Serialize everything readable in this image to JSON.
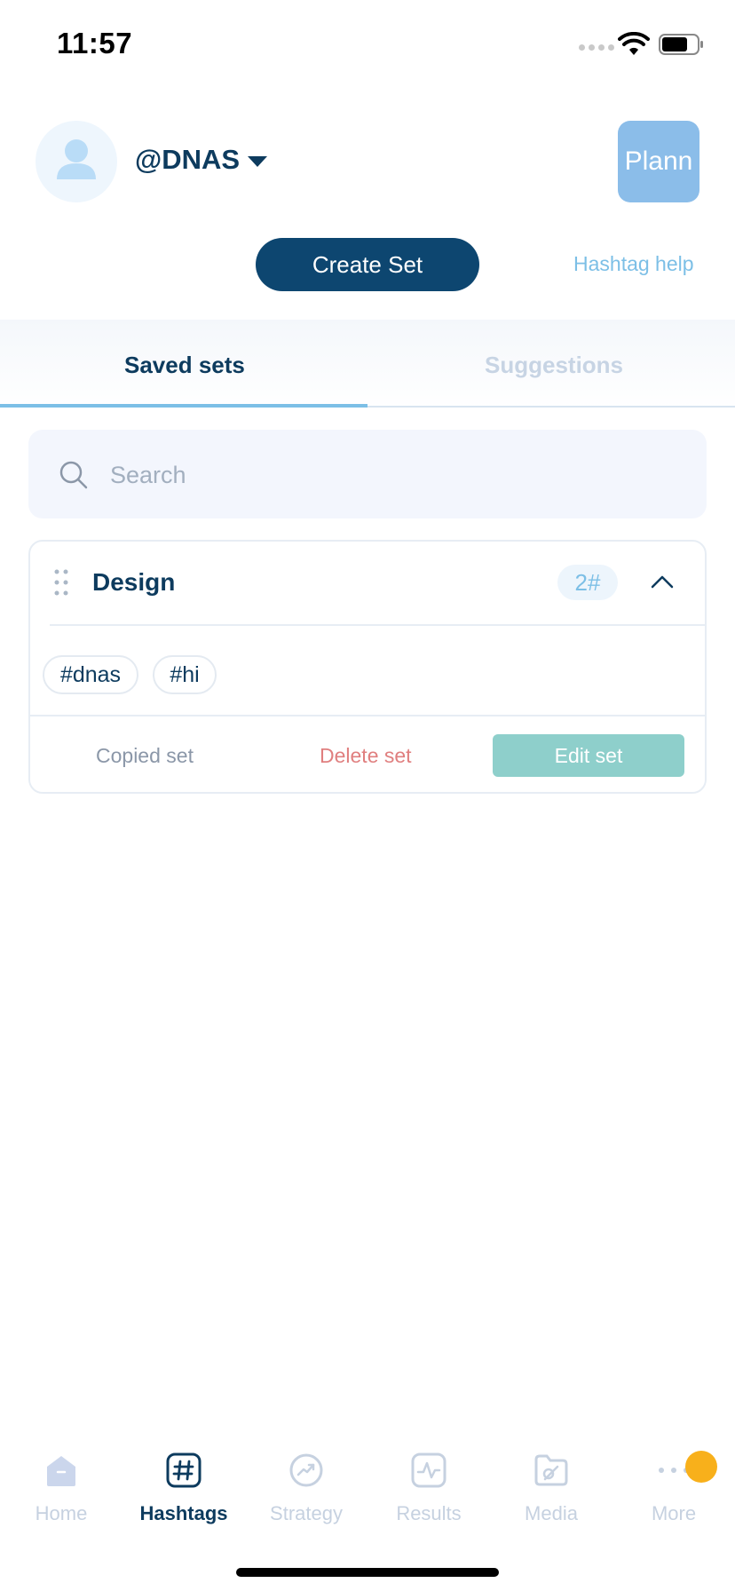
{
  "status_bar": {
    "time": "11:57"
  },
  "header": {
    "handle": "@DNAS",
    "plann_label": "Plann",
    "create_set_label": "Create Set",
    "hashtag_help_label": "Hashtag help"
  },
  "tabs": [
    {
      "label": "Saved sets",
      "active": true
    },
    {
      "label": "Suggestions",
      "active": false
    }
  ],
  "search": {
    "placeholder": "Search",
    "value": ""
  },
  "sets": [
    {
      "title": "Design",
      "count": "2#",
      "tags": [
        "#dnas",
        "#hi"
      ],
      "copied_label": "Copied set",
      "delete_label": "Delete set",
      "edit_label": "Edit set"
    }
  ],
  "nav": {
    "items": [
      {
        "label": "Home",
        "icon": "home-icon",
        "active": false
      },
      {
        "label": "Hashtags",
        "icon": "hashtag-icon",
        "active": true
      },
      {
        "label": "Strategy",
        "icon": "strategy-icon",
        "active": false
      },
      {
        "label": "Results",
        "icon": "results-icon",
        "active": false
      },
      {
        "label": "Media",
        "icon": "media-icon",
        "active": false
      },
      {
        "label": "More",
        "icon": "more-icon",
        "active": false
      }
    ]
  },
  "colors": {
    "primary": "#0d4670",
    "accent": "#7cbfe6",
    "edit_button": "#8ecfcb",
    "delete_text": "#e07f7f",
    "notification": "#f8b01b"
  }
}
